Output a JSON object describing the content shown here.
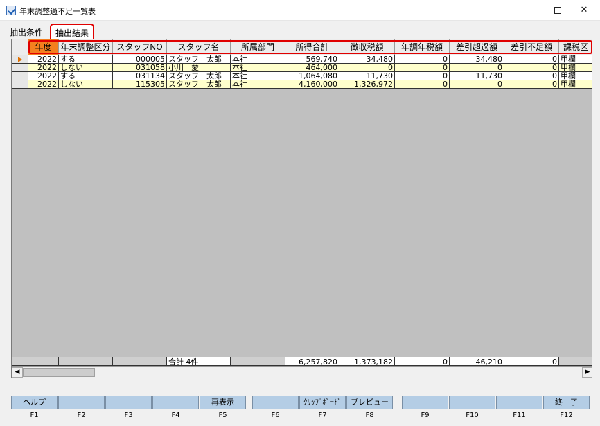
{
  "window": {
    "title": "年末調整過不足一覧表",
    "minimize": "—",
    "close": "✕"
  },
  "tabs": [
    {
      "label": "抽出条件"
    },
    {
      "label": "抽出結果"
    }
  ],
  "grid": {
    "columns": [
      {
        "key": "year",
        "label": "年度"
      },
      {
        "key": "adjust",
        "label": "年末調整区分"
      },
      {
        "key": "staff_no",
        "label": "スタッフNO"
      },
      {
        "key": "staff_name",
        "label": "スタッフ名"
      },
      {
        "key": "dept",
        "label": "所属部門"
      },
      {
        "key": "income",
        "label": "所得合計"
      },
      {
        "key": "withheld",
        "label": "徴収税額"
      },
      {
        "key": "annual_tax",
        "label": "年調年税額"
      },
      {
        "key": "excess",
        "label": "差引超過額"
      },
      {
        "key": "shortfall",
        "label": "差引不足額"
      },
      {
        "key": "tax_class",
        "label": "課税区"
      }
    ],
    "rows": [
      {
        "year": "2022",
        "adjust": "する",
        "staff_no": "000005",
        "staff_name": "スタッフ　太郎",
        "dept": "本社",
        "income": "569,740",
        "withheld": "34,480",
        "annual_tax": "0",
        "excess": "34,480",
        "shortfall": "0",
        "tax_class": "甲欄"
      },
      {
        "year": "2022",
        "adjust": "しない",
        "staff_no": "031058",
        "staff_name": "小川　愛",
        "dept": "本社",
        "income": "464,000",
        "withheld": "0",
        "annual_tax": "0",
        "excess": "0",
        "shortfall": "0",
        "tax_class": "甲欄"
      },
      {
        "year": "2022",
        "adjust": "する",
        "staff_no": "031134",
        "staff_name": "スタッフ　太郎",
        "dept": "本社",
        "income": "1,064,080",
        "withheld": "11,730",
        "annual_tax": "0",
        "excess": "11,730",
        "shortfall": "0",
        "tax_class": "甲欄"
      },
      {
        "year": "2022",
        "adjust": "しない",
        "staff_no": "115305",
        "staff_name": "スタッフ　太郎",
        "dept": "本社",
        "income": "4,160,000",
        "withheld": "1,326,972",
        "annual_tax": "0",
        "excess": "0",
        "shortfall": "0",
        "tax_class": "甲欄"
      }
    ],
    "totals": {
      "label": "合計 4件",
      "income": "6,257,820",
      "withheld": "1,373,182",
      "annual_tax": "0",
      "excess": "46,210",
      "shortfall": "0"
    },
    "colors": {
      "header_active": "#f47f1f",
      "row_even": "#ffffff",
      "row_odd": "#ffffcc",
      "highlight": "#e00000"
    }
  },
  "function_keys": [
    {
      "key": "F1",
      "label": "ヘルプ"
    },
    {
      "key": "F2",
      "label": ""
    },
    {
      "key": "F3",
      "label": ""
    },
    {
      "key": "F4",
      "label": ""
    },
    {
      "key": "F5",
      "label": "再表示"
    },
    {
      "key": "F6",
      "label": ""
    },
    {
      "key": "F7",
      "label": "ｸﾘｯﾌﾟﾎﾞｰﾄﾞ"
    },
    {
      "key": "F8",
      "label": "プレビュー"
    },
    {
      "key": "F9",
      "label": ""
    },
    {
      "key": "F10",
      "label": ""
    },
    {
      "key": "F11",
      "label": ""
    },
    {
      "key": "F12",
      "label": "終　了"
    }
  ]
}
